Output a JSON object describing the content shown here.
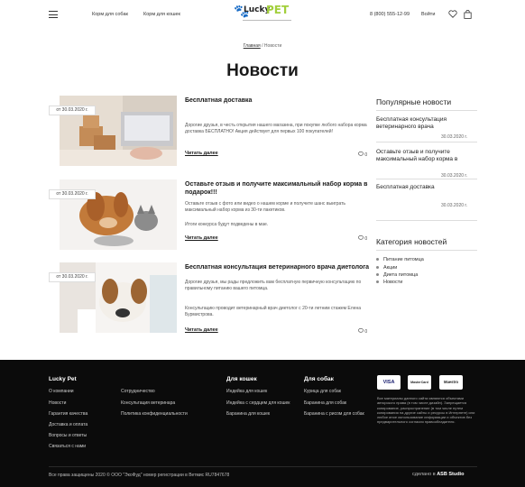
{
  "header": {
    "nav": [
      "Корм для собак",
      "Корм для кошек"
    ],
    "logo_lucky": "Lucky",
    "logo_pet": "PET",
    "phone": "8 (800) 555-12-99",
    "login": "Войти"
  },
  "breadcrumb": {
    "home": "Главная",
    "sep": " / ",
    "current": "Новости"
  },
  "page_title": "Новости",
  "read_more": "Читать далее",
  "news": [
    {
      "date": "от 30.03.2020 г.",
      "title": "Бесплатная доставка",
      "paragraphs": [
        "Дорогие друзья, в честь открытия нашего магазина, при покупке любого набора корма доставка БЕСПЛАТНО! Акция действует для первых 100 покупателей!"
      ],
      "comments": "0"
    },
    {
      "date": "от 30.03.2020 г.",
      "title": "Оставьте отзыв и получите максимальный набор корма в подарок!!!",
      "paragraphs": [
        "Оставьте отзыв с фото или видео о нашем корме и получите шанс выиграть максимальный набор корма из 30-ти пакетиков.",
        "Итоги конкурса будут подведены в мае."
      ],
      "comments": "0"
    },
    {
      "date": "от 30.03.2020 г.",
      "title": "Бесплатная консультация ветеринарного врача диетолога",
      "paragraphs": [
        "Дорогие друзья, мы рады предложить вам бесплатную первичную консультацию по правильному питанию вашего питомца.",
        "Консультацию проводит ветеринарный врач диетолог с 20-ти летним стажем Елена Бурмистрова."
      ],
      "comments": "0"
    }
  ],
  "sidebar": {
    "popular_heading": "Популярные новости",
    "popular": [
      {
        "title": "Бесплатная консультация ветеринарного врача",
        "date": "30.03.2020 г."
      },
      {
        "title": "Оставьте отзыв и получите максимальный набор корма в",
        "date": "30.03.2020 г."
      },
      {
        "title": "Бесплатная доставка",
        "date": "30.03.2020 г."
      }
    ],
    "category_heading": "Категория новостей",
    "categories": [
      "Питание питомца",
      "Акции",
      "Диета питомца",
      "Новости"
    ]
  },
  "footer": {
    "col1_heading": "Lucky Pet",
    "col1": [
      "О компании",
      "Новости",
      "Гарантия качества",
      "Доставка и оплата",
      "Вопросы и ответы",
      "Связаться с нами"
    ],
    "col2": [
      "Сотрудничество",
      "Консультация ветеринара",
      "Политика конфиденциальности"
    ],
    "col3_heading": "Для кошек",
    "col3": [
      "Индейка для кошек",
      "Индейка с сердцем для кошек",
      "Баранина для кошек"
    ],
    "col4_heading": "Для собак",
    "col4": [
      "Курица для собак",
      "Баранина для собак",
      "Баранина с рисом для собак"
    ],
    "payments": [
      "VISA",
      "MasterCard",
      "Maestro"
    ],
    "legal_note": "Все материалы данного сайта являются объектами авторского права (в том числе дизайн). Запрещается копирование, распространение (в том числе путем копирования на другие сайты и ресурсы в Интернете) или любое иное использование информации и объектов без предварительного согласия правообладателя.",
    "copyright": "Все права защищены 2020 © ООО \"ЭкоФуд\" номер регистрации в Ветмис RU7847678",
    "made_by_prefix": "сделано в",
    "made_by": "ASB Studio"
  },
  "colors": {
    "brand_green": "#a2cf3c",
    "footer_bg": "#0b0b0b"
  },
  "icons": [
    "menu-icon",
    "heart-icon",
    "bag-icon",
    "comment-icon"
  ]
}
